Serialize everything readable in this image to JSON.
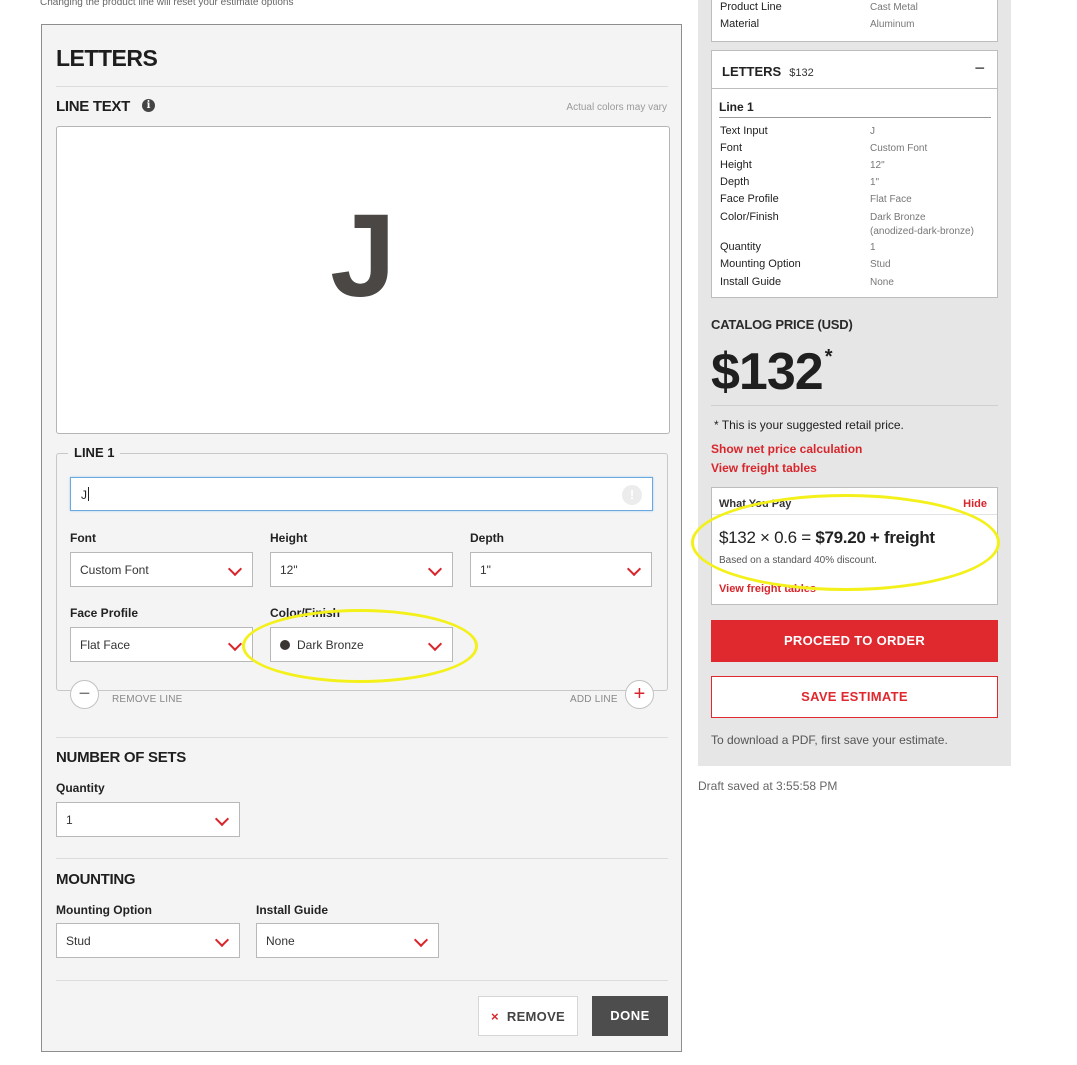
{
  "top_note": "Changing the product line will reset your estimate options",
  "editor": {
    "title": "LETTERS",
    "line_text_heading": "LINE TEXT",
    "color_disclaimer": "Actual colors may vary",
    "preview_text": "J",
    "line_legend": "LINE 1",
    "text_value": "J",
    "font_label": "Font",
    "font_value": "Custom Font",
    "height_label": "Height",
    "height_value": "12\"",
    "depth_label": "Depth",
    "depth_value": "1\"",
    "face_label": "Face Profile",
    "face_value": "Flat Face",
    "color_label": "Color/Finish",
    "color_value": "Dark Bronze",
    "remove_line": "REMOVE LINE",
    "add_line": "ADD LINE",
    "sets_heading": "NUMBER OF SETS",
    "quantity_label": "Quantity",
    "quantity_value": "1",
    "mounting_heading": "MOUNTING",
    "mounting_label": "Mounting Option",
    "mounting_value": "Stud",
    "install_label": "Install Guide",
    "install_value": "None",
    "remove_button": "REMOVE",
    "done_button": "DONE"
  },
  "summary": {
    "top_rows": [
      {
        "k": "Product Line",
        "v": "Cast Metal"
      },
      {
        "k": "Material",
        "v": "Aluminum"
      }
    ],
    "letters_title": "LETTERS",
    "letters_price": "$132",
    "line_title": "Line 1",
    "rows": [
      {
        "k": "Text Input",
        "v": "J"
      },
      {
        "k": "Font",
        "v": "Custom Font"
      },
      {
        "k": "Height",
        "v": "12\""
      },
      {
        "k": "Depth",
        "v": "1\""
      },
      {
        "k": "Face Profile",
        "v": "Flat Face"
      },
      {
        "k": "Color/Finish",
        "v": "Dark Bronze"
      },
      {
        "k": "Quantity",
        "v": "1"
      },
      {
        "k": "Mounting Option",
        "v": "Stud"
      },
      {
        "k": "Install Guide",
        "v": "None"
      }
    ],
    "color_code": "(anodized-dark-bronze)",
    "catalog_label": "CATALOG PRICE (USD)",
    "catalog_price": "$132",
    "asterisk": "*",
    "retail_note": "* This is your suggested retail price.",
    "net_price_link": "Show net price calculation",
    "freight_link": "View freight tables",
    "what_you_pay": "What You Pay",
    "hide_link": "Hide",
    "calc_prefix": "$132 × 0.6 = ",
    "calc_result": "$79.20 + freight",
    "discount_note": "Based on a standard 40% discount.",
    "freight_link_2": "View freight tables",
    "proceed_button": "PROCEED TO ORDER",
    "save_button": "SAVE ESTIMATE",
    "pdf_note": "To download a PDF, first save your estimate."
  },
  "draft_saved": "Draft saved at 3:55:58 PM",
  "colors": {
    "accent_red": "#e0282f",
    "highlight_yellow": "#f3f01a",
    "bronze": "#3a3532"
  }
}
